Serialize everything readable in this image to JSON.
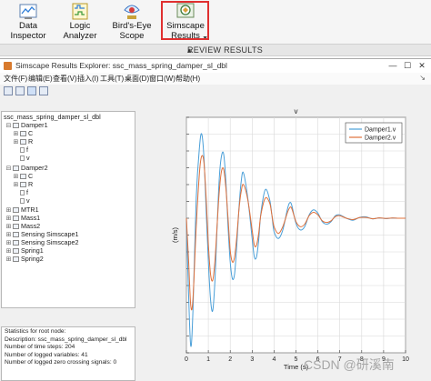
{
  "ribbon": {
    "buttons": [
      {
        "line1": "Data",
        "line2": "Inspector",
        "icon": "data-inspector-icon"
      },
      {
        "line1": "Logic",
        "line2": "Analyzer",
        "icon": "logic-analyzer-icon"
      },
      {
        "line1": "Bird's-Eye",
        "line2": "Scope",
        "icon": "birds-eye-scope-icon"
      },
      {
        "line1": "Simscape",
        "line2": "Results",
        "icon": "simscape-results-icon"
      }
    ],
    "more_glyph": "▼",
    "section_label": "REVIEW RESULTS",
    "selected_highlight_color": "#e03030"
  },
  "window": {
    "title": "Simscape Results Explorer: ssc_mass_spring_damper_sl_dbl",
    "controls": {
      "minimize": "—",
      "maximize": "☐",
      "close": "✕"
    },
    "menus": [
      "文件(F)",
      "编辑(E)",
      "查看(V)",
      "插入(I)",
      "工具(T)",
      "桌面(D)",
      "窗口(W)",
      "帮助(H)"
    ],
    "menu_arrow": "↘"
  },
  "tree": {
    "rows": [
      {
        "label": "ssc_mass_spring_damper_sl_dbl",
        "twist": "",
        "kind": "root"
      },
      {
        "label": "Damper1",
        "twist": "⊟",
        "kind": "block"
      },
      {
        "label": "C",
        "twist": "⊞",
        "kind": "block"
      },
      {
        "label": "R",
        "twist": "⊞",
        "kind": "block"
      },
      {
        "label": "f",
        "twist": "",
        "kind": "leaf"
      },
      {
        "label": "v",
        "twist": "",
        "kind": "leaf"
      },
      {
        "label": "Damper2",
        "twist": "⊟",
        "kind": "block"
      },
      {
        "label": "C",
        "twist": "⊞",
        "kind": "block"
      },
      {
        "label": "R",
        "twist": "⊞",
        "kind": "block"
      },
      {
        "label": "f",
        "twist": "",
        "kind": "leaf"
      },
      {
        "label": "v",
        "twist": "",
        "kind": "leaf"
      },
      {
        "label": "MTR1",
        "twist": "⊞",
        "kind": "block"
      },
      {
        "label": "Mass1",
        "twist": "⊞",
        "kind": "block"
      },
      {
        "label": "Mass2",
        "twist": "⊞",
        "kind": "block"
      },
      {
        "label": "Sensing Simscape1",
        "twist": "⊞",
        "kind": "block"
      },
      {
        "label": "Sensing Simscape2",
        "twist": "⊞",
        "kind": "block"
      },
      {
        "label": "Spring1",
        "twist": "⊞",
        "kind": "block"
      },
      {
        "label": "Spring2",
        "twist": "⊞",
        "kind": "block"
      }
    ]
  },
  "stats": {
    "lines": [
      "Statistics for root node:",
      "Description: ssc_mass_spring_damper_sl_dbl",
      "Number of time steps: 204",
      "Number of logged variables: 41",
      "Number of logged zero crossing signals: 0"
    ]
  },
  "watermark": "CSDN @研溪南",
  "chart_data": {
    "type": "line",
    "title": "v",
    "xlabel": "Time (s)",
    "ylabel": "(m/s)",
    "xlim": [
      0,
      10
    ],
    "ylim": [
      -8,
      6
    ],
    "x_ticks": [
      0,
      1,
      2,
      3,
      4,
      5,
      6,
      7,
      8,
      9,
      10
    ],
    "y_ticks": [
      -8,
      -7,
      -6,
      -5,
      -4,
      -3,
      -2,
      -1,
      0,
      1,
      2,
      3,
      4,
      5,
      6
    ],
    "grid": true,
    "legend": "top-right",
    "series": [
      {
        "name": "Damper1.v",
        "color": "#4a9fd8",
        "x": [
          0,
          0.1,
          0.2,
          0.3,
          0.45,
          0.6,
          0.7,
          0.8,
          0.9,
          1.0,
          1.1,
          1.2,
          1.3,
          1.4,
          1.5,
          1.6,
          1.7,
          1.8,
          1.9,
          2.0,
          2.1,
          2.2,
          2.3,
          2.4,
          2.5,
          2.6,
          2.8,
          3.0,
          3.1,
          3.2,
          3.3,
          3.4,
          3.6,
          3.8,
          3.9,
          4.0,
          4.2,
          4.4,
          4.6,
          4.7,
          4.8,
          5.0,
          5.2,
          5.4,
          5.6,
          5.8,
          6.0,
          6.2,
          6.4,
          6.6,
          6.8,
          7.0,
          7.3,
          7.6,
          7.9,
          8.2,
          8.5,
          8.8,
          9.1,
          9.4,
          9.7,
          10.0
        ],
        "values": [
          0,
          -4.5,
          -7.6,
          -5.5,
          1.2,
          4.3,
          5.0,
          3.6,
          0.5,
          -2.5,
          -4.8,
          -5.5,
          -3.8,
          -0.6,
          2.4,
          3.7,
          3.8,
          2.2,
          -0.5,
          -2.6,
          -3.6,
          -3.3,
          -1.6,
          0.6,
          2.2,
          2.7,
          1.2,
          -1.2,
          -2.3,
          -2.3,
          -1.3,
          0.3,
          1.7,
          1.1,
          0.2,
          -0.8,
          -1.2,
          -0.7,
          0.5,
          0.9,
          0.8,
          -0.3,
          -0.7,
          -0.5,
          0.2,
          0.5,
          0.3,
          -0.2,
          -0.35,
          -0.2,
          0.15,
          0.2,
          0.0,
          -0.12,
          0.05,
          0.08,
          -0.04,
          0.02,
          -0.02,
          0.01,
          0.0,
          0.0
        ]
      },
      {
        "name": "Damper2.v",
        "color": "#e0703a",
        "x": [
          0,
          0.1,
          0.2,
          0.3,
          0.45,
          0.6,
          0.7,
          0.8,
          0.9,
          1.0,
          1.1,
          1.2,
          1.3,
          1.4,
          1.5,
          1.6,
          1.7,
          1.8,
          1.9,
          2.0,
          2.1,
          2.2,
          2.3,
          2.4,
          2.5,
          2.6,
          2.8,
          3.0,
          3.1,
          3.2,
          3.3,
          3.4,
          3.6,
          3.8,
          3.9,
          4.0,
          4.2,
          4.4,
          4.6,
          4.7,
          4.8,
          5.0,
          5.2,
          5.4,
          5.6,
          5.8,
          6.0,
          6.2,
          6.4,
          6.6,
          6.8,
          7.0,
          7.3,
          7.6,
          7.9,
          8.2,
          8.5,
          8.8,
          9.1,
          9.4,
          9.7,
          10.0
        ],
        "values": [
          0,
          -2.5,
          -5.2,
          -4.8,
          -0.5,
          2.8,
          3.7,
          3.3,
          1.2,
          -1.5,
          -3.3,
          -3.7,
          -2.6,
          -0.5,
          1.6,
          2.8,
          2.9,
          1.8,
          0.0,
          -1.9,
          -2.6,
          -2.3,
          -1.1,
          0.5,
          1.6,
          2.0,
          1.1,
          -0.7,
          -1.6,
          -1.6,
          -0.9,
          0.2,
          1.2,
          0.9,
          0.2,
          -0.5,
          -0.9,
          -0.5,
          0.3,
          0.6,
          0.6,
          -0.2,
          -0.5,
          -0.35,
          0.15,
          0.35,
          0.2,
          -0.15,
          -0.25,
          -0.15,
          0.1,
          0.15,
          0.0,
          -0.08,
          0.04,
          0.05,
          -0.03,
          0.02,
          -0.01,
          0.01,
          0.0,
          0.0
        ]
      }
    ]
  }
}
